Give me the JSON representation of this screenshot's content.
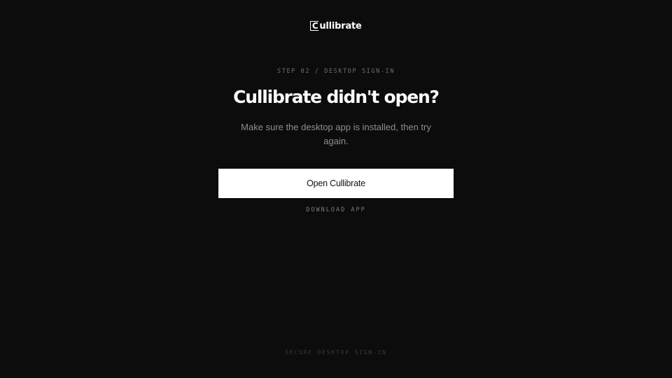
{
  "brand": {
    "mark": "C",
    "name": "ullibrate"
  },
  "step": {
    "label": "STEP 02 / DESKTOP SIGN-IN"
  },
  "main": {
    "headline": "Cullibrate didn't open?",
    "subtitle": "Make sure the desktop app is installed, then try again.",
    "open_button_label": "Open Cullibrate",
    "download_link_label": "DOWNLOAD APP"
  },
  "footer": {
    "note": "SECURE DESKTOP SIGN-IN"
  },
  "colors": {
    "background": "#0c0c0c",
    "text": "#ffffff",
    "muted": "#8e8e8e",
    "button_bg": "#ffffff",
    "button_text": "#111111"
  }
}
